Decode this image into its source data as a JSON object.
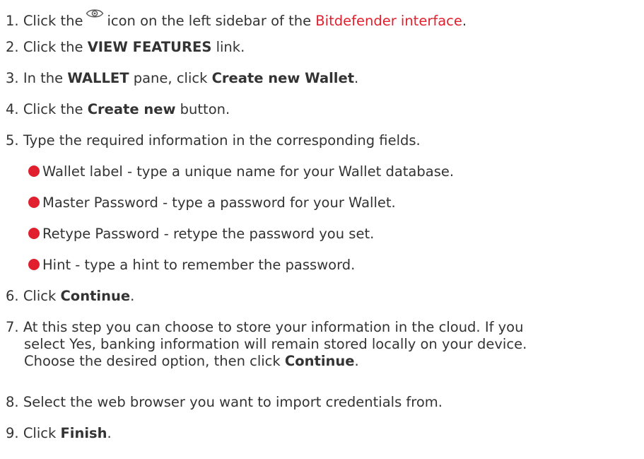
{
  "steps": [
    {
      "num": "1.",
      "before_icon": "Click the",
      "icon": "eye-icon",
      "after_icon": "icon on the left sidebar of the",
      "link": "Bitdefender interface",
      "end": "."
    },
    {
      "num": "2.",
      "pre": "Click the",
      "bold": "VIEW FEATURES",
      "post": "link."
    },
    {
      "num": "3.",
      "pre": "In the",
      "bold1": "WALLET",
      "mid": "pane, click",
      "bold2": "Create new Wallet",
      "post": "."
    },
    {
      "num": "4.",
      "pre": "Click the",
      "bold": "Create new",
      "post": "button."
    },
    {
      "num": "5.",
      "text": "Type the required information in the corresponding fields."
    },
    {
      "num": "6.",
      "pre": "Click",
      "bold": "Continue",
      "post": "."
    },
    {
      "num": "7.",
      "line1": "At this step you can choose to store your information in the cloud. If you",
      "line2": "select Yes, banking information will remain stored locally on your device.",
      "line3_pre": "Choose the desired option, then click",
      "line3_bold": "Continue",
      "line3_post": "."
    },
    {
      "num": "8.",
      "text": "Select the web browser you want to import credentials from."
    },
    {
      "num": "9.",
      "pre": "Click",
      "bold": "Finish",
      "post": "."
    }
  ],
  "fields": [
    "Wallet label - type a unique name for your Wallet database.",
    "Master Password - type a password for your Wallet.",
    "Retype Password - retype the password you set.",
    "Hint - type a hint to remember the password."
  ],
  "colors": {
    "text": "#333333",
    "accent": "#e0202f"
  }
}
